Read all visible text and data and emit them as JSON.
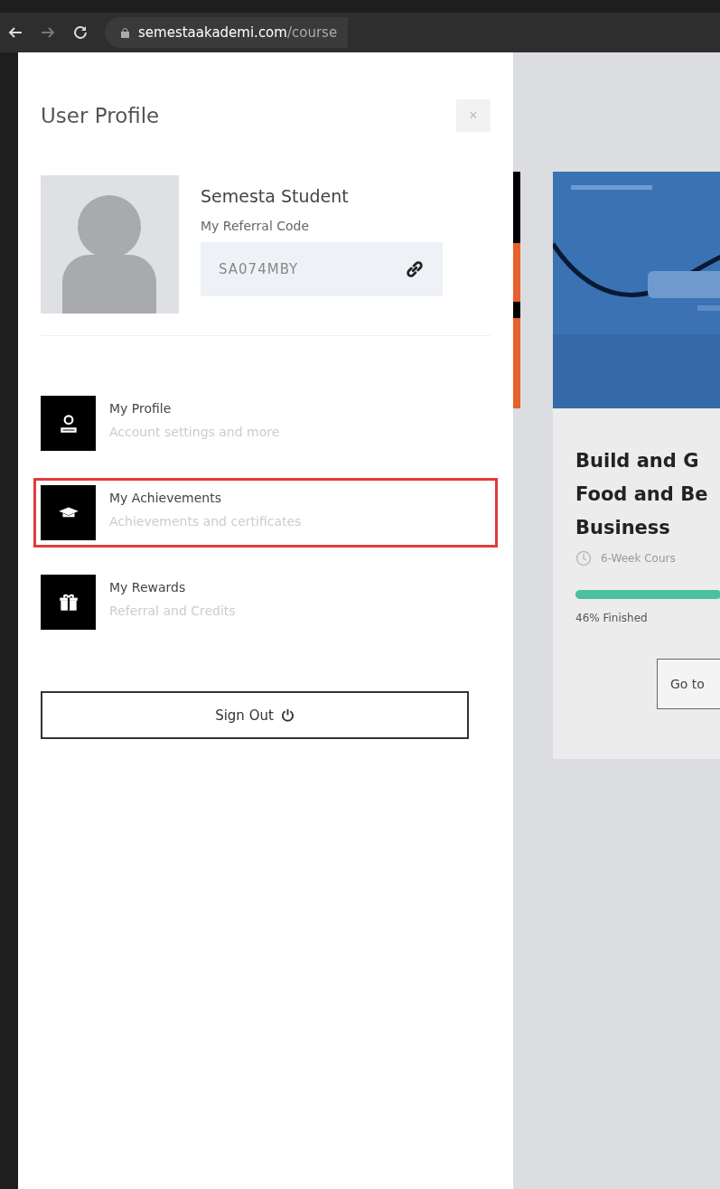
{
  "browser": {
    "url_host": "semestaakademi.com",
    "url_path": "/course"
  },
  "panel": {
    "title": "User Profile",
    "close": "×",
    "name": "Semesta Student",
    "referral_label": "My Referral Code",
    "referral_code": "SA074MBY",
    "menu": [
      {
        "kind": "profile",
        "title": "My Profile",
        "subtitle": "Account settings and more",
        "selected": false
      },
      {
        "kind": "achievements",
        "title": "My Achievements",
        "subtitle": "Achievements and certificates",
        "selected": true
      },
      {
        "kind": "rewards",
        "title": "My Rewards",
        "subtitle": "Referral and Credits",
        "selected": false
      }
    ],
    "sign_out": "Sign Out"
  },
  "course": {
    "title_lines": [
      "Build and G",
      "Food and Be",
      "Business"
    ],
    "duration": "6-Week Cours",
    "level": 0.46,
    "progress_text": "46% Finished",
    "button": "Go to"
  }
}
